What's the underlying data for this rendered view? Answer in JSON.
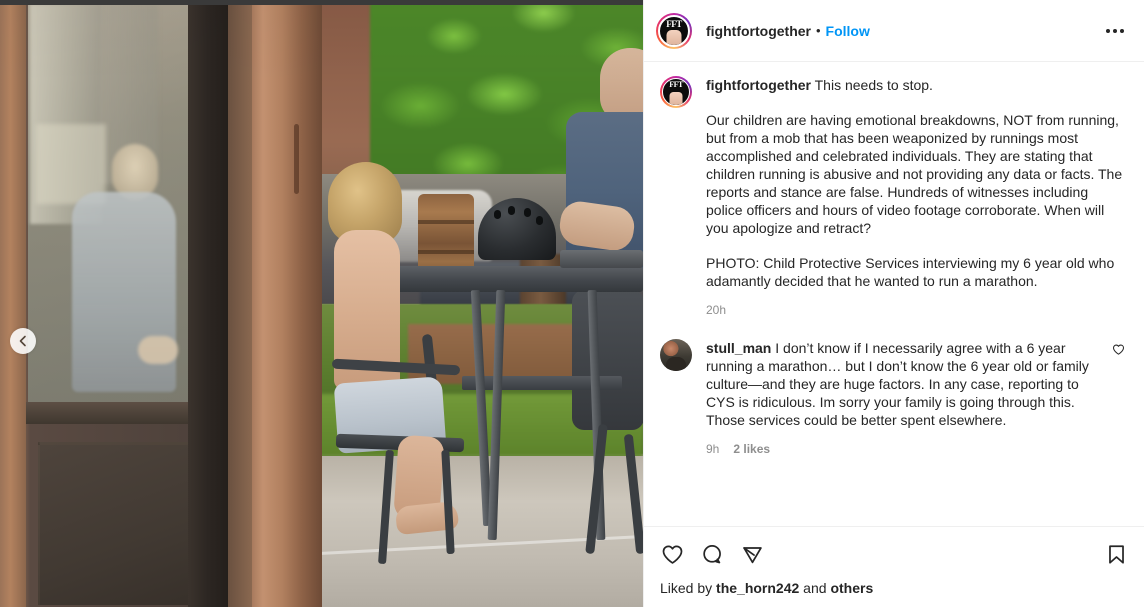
{
  "post": {
    "header": {
      "username": "fightfortogether",
      "separator": "•",
      "follow_label": "Follow",
      "more_label": "more-options",
      "avatar_initials": "FFT",
      "accent_color": "#0095f6"
    },
    "caption": {
      "username": "fightfortogether",
      "paragraphs": [
        "This needs to stop.",
        "Our children are having emotional breakdowns, NOT from running, but from a mob that has been weaponized by runnings most accomplished and celebrated individuals. They are stating that children running is abusive and not providing any data or facts. The reports and stance are false. Hundreds of witnesses including police officers and hours of video footage corroborate. When will you apologize and retract?",
        "PHOTO: Child Protective Services interviewing my 6 year old who adamantly decided that he wanted to run a marathon."
      ],
      "timestamp": "20h"
    },
    "comments": [
      {
        "username": "stull_man",
        "text": "I don’t know if I necessarily agree with a 6 year running a marathon… but I don’t know the 6 year old or family culture—and they are huge factors. In any case, reporting to CYS is ridiculous. Im sorry your family is going through this. Those services could be better spent elsewhere.",
        "timestamp": "9h",
        "likes": "2 likes"
      }
    ],
    "actions": {
      "like": "like",
      "comment": "comment",
      "share": "share",
      "save": "save"
    },
    "liked_by": {
      "prefix": "Liked by ",
      "user": "the_horn242",
      "middle": " and ",
      "suffix": "others"
    },
    "media": {
      "prev_label": "previous-media"
    }
  }
}
